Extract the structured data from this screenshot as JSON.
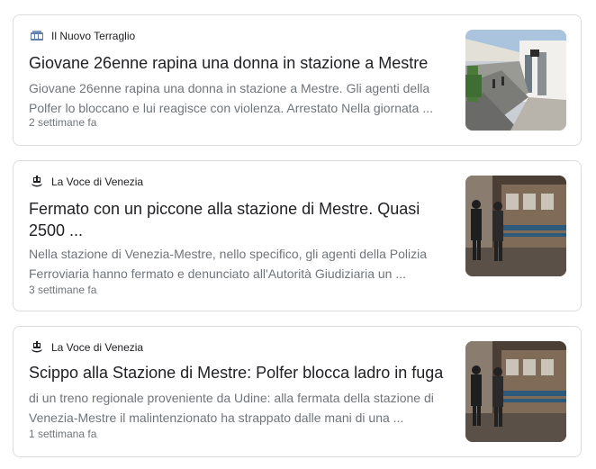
{
  "results": [
    {
      "source": "Il Nuovo Terraglio",
      "source_icon": "newspaper-logo-icon",
      "title": "Giovane 26enne rapina una donna in stazione a Mestre",
      "snippet": "Giovane 26enne rapina una donna in stazione a Mestre. Gli agenti della Polfer lo bloccano e lui reagisce con violenza. Arrestato Nella giornata ...",
      "time": "2 settimane fa",
      "thumbnail": "station-platform-image"
    },
    {
      "source": "La Voce di Venezia",
      "source_icon": "gondola-logo-icon",
      "title": "Fermato con un piccone alla stazione di Mestre. Quasi 2500 ...",
      "snippet": "Nella stazione di Venezia-Mestre, nello specifico, gli agenti della Polizia Ferroviaria hanno fermato e denunciato all'Autorità Giudiziaria un ...",
      "time": "3 settimane fa",
      "thumbnail": "train-police-image"
    },
    {
      "source": "La Voce di Venezia",
      "source_icon": "gondola-logo-icon",
      "title": "Scippo alla Stazione di Mestre: Polfer blocca ladro in fuga",
      "snippet": "di un treno regionale proveniente da Udine: alla fermata della stazione di Venezia-Mestre il malintenzionato ha strappato dalle mani di una ...",
      "time": "1 settimana fa",
      "thumbnail": "train-police-image"
    }
  ]
}
